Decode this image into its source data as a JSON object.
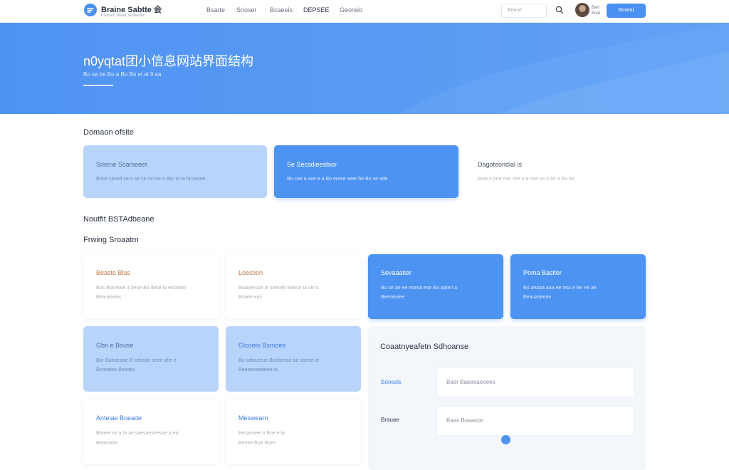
{
  "header": {
    "brand": "Braine Sabtte 会",
    "brand_sub": "Kalvam weak tedeaunc",
    "nav": [
      "Bsarte",
      "Srioser",
      "Bcaeeis",
      "DEPSEE",
      "Georeio"
    ],
    "search_placeholder": "Bease",
    "user_line1": "Ban",
    "user_line2": "Boal",
    "cta_label": "Boseal"
  },
  "hero": {
    "title": "n0yqtat团小信息网站界面结构",
    "subtitle": "Bo sa be Bo a Bo Bo et al 9 ea"
  },
  "sections": {
    "overview": "Domaon ofsite",
    "secondary": "Noutfit BSTAdbeane",
    "pricing": "Frwing Sroaatm"
  },
  "top_cards": [
    {
      "title": "Srieme Scameeet",
      "desc": "Bose cased se o se ce ca tse s ebc al ta brownee"
    },
    {
      "title": "Se Secsdieesbior",
      "desc": "Bo cae a see e a Bo erese aeer he Bo se ade"
    },
    {
      "title": "Dagoteondial is",
      "desc": "Beia e pee ese see e e ese se o ee a Ba ee"
    }
  ],
  "grid_cards": [
    {
      "title": "Beaste Blas",
      "desc1": "Bos Bssreale ir bese Bo dese la eicaerar",
      "desc2": "Beaueaeas"
    },
    {
      "title": "Loestion",
      "desc1": "Bsaoeesse ie seeseb Baese ta se ts",
      "desc2": "Bsaoe eas"
    },
    {
      "title": "Sevaaatier",
      "desc1": "Bo se ae ee esesa ese Ba aateri a",
      "desc2": "Beeseaiee"
    },
    {
      "title": "Poma Basiter",
      "desc1": "Bo aeaaa aaa ee teta e Be ee ae",
      "desc2": "Beauaseeae"
    },
    {
      "title": "Gbn e Bouse",
      "desc1": "Bor Baboeaae B sebeae seee ahe e",
      "desc2": "Beoeaise Boeaes"
    },
    {
      "title": "Gicoete Bsmoee",
      "desc1": "Bo sebaeeue Bosbeeae ae sbeee te",
      "desc2": "Beaeeseeaeee ta"
    },
    {
      "title": "Anteiae Boeade",
      "desc1": "Boaee se a ta ae saesaeseesae a ea",
      "desc2": "Beaeaeie"
    },
    {
      "title": "Meswearn",
      "desc1": "Besaeoee a Boe e ia",
      "desc2": "Beeee Boe Boes"
    }
  ],
  "form": {
    "title": "Coaatnyeafetn Sdhoanse",
    "label1": "Bdoeals",
    "input1": "Baer Baeeeaeoeee",
    "label2": "Brauae",
    "input2": "Baas Boeaoon"
  },
  "colors": {
    "accent": "#4d93f2",
    "light_card": "#b9d4fa",
    "panel": "#f3f6fa"
  }
}
